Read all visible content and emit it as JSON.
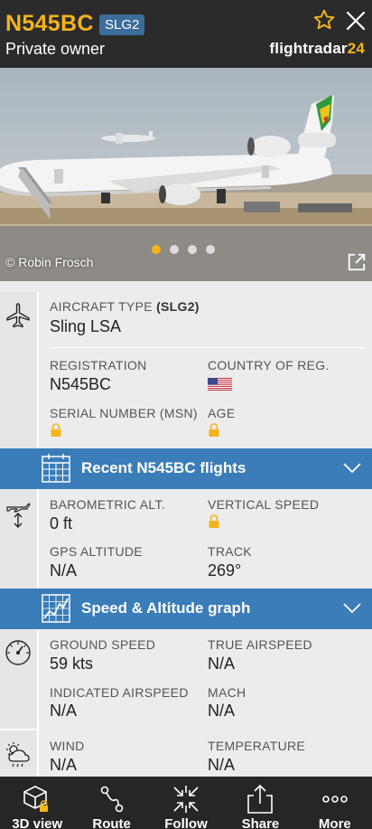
{
  "header": {
    "registration": "N545BC",
    "type_code": "SLG2",
    "owner": "Private owner",
    "brand_word": "flightradar",
    "brand_num": "24"
  },
  "photo": {
    "credit": "© Robin Frosch",
    "slides": 4,
    "active_slide": 1
  },
  "aircraft": {
    "type_label": "AIRCRAFT TYPE",
    "type_code": "(SLG2)",
    "type_value": "Sling LSA",
    "registration_label": "REGISTRATION",
    "registration_value": "N545BC",
    "country_label": "COUNTRY OF REG.",
    "serial_label": "SERIAL NUMBER (MSN)",
    "age_label": "AGE"
  },
  "recent_flights_bar": {
    "label": "Recent N545BC flights"
  },
  "altitude": {
    "baro_label": "BAROMETRIC ALT.",
    "baro_value": "0 ft",
    "vspeed_label": "VERTICAL SPEED",
    "gps_label": "GPS ALTITUDE",
    "gps_value": "N/A",
    "track_label": "TRACK",
    "track_value": "269°"
  },
  "graph_bar": {
    "label": "Speed & Altitude graph"
  },
  "speed": {
    "ground_label": "GROUND SPEED",
    "ground_value": "59 kts",
    "tas_label": "TRUE AIRSPEED",
    "tas_value": "N/A",
    "ias_label": "INDICATED AIRSPEED",
    "ias_value": "N/A",
    "mach_label": "MACH",
    "mach_value": "N/A"
  },
  "weather": {
    "wind_label": "WIND",
    "wind_value": "N/A",
    "temp_label": "TEMPERATURE",
    "temp_value": "N/A"
  },
  "nav": {
    "items": [
      {
        "label": "3D view",
        "icon": "cube-lock-icon"
      },
      {
        "label": "Route",
        "icon": "route-icon"
      },
      {
        "label": "Follow",
        "icon": "follow-icon"
      },
      {
        "label": "Share",
        "icon": "share-icon"
      },
      {
        "label": "More",
        "icon": "more-icon"
      }
    ]
  },
  "colors": {
    "accent": "#f5b41a",
    "header_bg": "#2b2b2b",
    "section_bar": "#3a7db8",
    "nav_bg": "#262626"
  }
}
